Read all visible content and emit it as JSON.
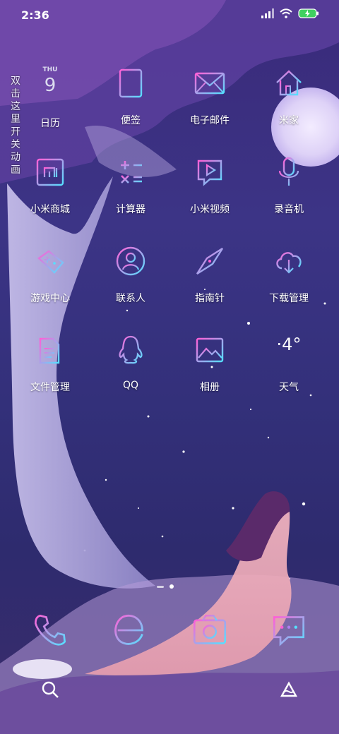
{
  "status_bar": {
    "time": "2:36"
  },
  "side_hint": {
    "text": "双击这里开关动画"
  },
  "calendar": {
    "day_of_week": "THU",
    "day_number": "9"
  },
  "weather": {
    "temperature": "·4°"
  },
  "apps": {
    "calendar": "日历",
    "notes": "便签",
    "email": "电子邮件",
    "mijia": "米家",
    "mi_store": "小米商城",
    "calculator": "计算器",
    "mi_video": "小米视频",
    "recorder": "录音机",
    "game_center": "游戏中心",
    "contacts": "联系人",
    "compass": "指南针",
    "downloads": "下载管理",
    "file_manager": "文件管理",
    "qq": "QQ",
    "gallery": "相册",
    "weather": "天气"
  },
  "colors": {
    "icon_gradient_start": "#ff5fd6",
    "icon_gradient_end": "#55e0ff",
    "background": "#33307a"
  }
}
